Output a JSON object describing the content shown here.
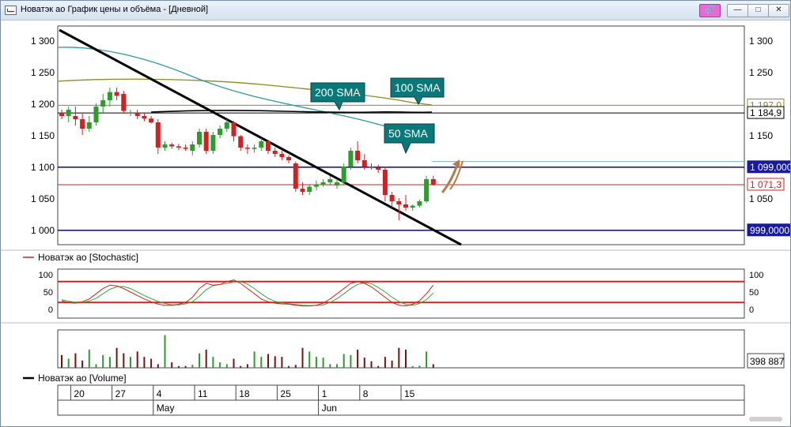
{
  "window": {
    "title": "Новатэк ао График цены и объёма - [Дневной]",
    "pin_icon": "pin-icon",
    "minimize_label": "—",
    "maximize_label": "□",
    "close_label": "✕"
  },
  "price_panel": {
    "y_ticks": [
      "1 300",
      "1 250",
      "1 200",
      "1 150",
      "1 100",
      "1 050",
      "1 000"
    ],
    "right_labels": [
      {
        "text": "1 197,0",
        "value": 1197.0,
        "color": "#8b8b1e"
      },
      {
        "text": "1 184,9",
        "value": 1184.9,
        "color": "#000000"
      },
      {
        "text": "1 099,000",
        "value": 1099.0,
        "color": "#1a1aa0"
      },
      {
        "text": "1 071,3",
        "value": 1071.3,
        "color": "#cc2222"
      },
      {
        "text": "999,0000",
        "value": 999.0,
        "color": "#1a1aa0"
      }
    ],
    "callouts": [
      "200 SMA",
      "100 SMA",
      "50 SMA"
    ]
  },
  "stoch_panel": {
    "legend": "Новатэк ао [Stochastic]",
    "y_ticks": [
      "100",
      "50",
      "0"
    ]
  },
  "volume_panel": {
    "legend": "Новатэк ао [Volume]",
    "last_value": "398 887"
  },
  "x_axis": {
    "day_labels": [
      "20",
      "27",
      "4",
      "11",
      "18",
      "25",
      "1",
      "8",
      "15"
    ],
    "month_labels": [
      "May",
      "Jun"
    ]
  },
  "chart_data": {
    "type": "candlestick",
    "ylim": [
      975,
      1320
    ],
    "levels": {
      "resistance_1": 1184.9,
      "sma200_last": 1197.0,
      "support_upper": 1099.0,
      "last_price": 1071.3,
      "support_lower": 999.0
    },
    "candles": [
      [
        1185,
        1190,
        1175,
        1180
      ],
      [
        1180,
        1195,
        1170,
        1190
      ],
      [
        1180,
        1195,
        1165,
        1175
      ],
      [
        1175,
        1185,
        1150,
        1160
      ],
      [
        1160,
        1180,
        1155,
        1170
      ],
      [
        1170,
        1200,
        1165,
        1195
      ],
      [
        1195,
        1215,
        1185,
        1205
      ],
      [
        1205,
        1225,
        1195,
        1218
      ],
      [
        1218,
        1225,
        1205,
        1212
      ],
      [
        1215,
        1220,
        1185,
        1188
      ],
      [
        1185,
        1190,
        1180,
        1185
      ],
      [
        1185,
        1190,
        1175,
        1180
      ],
      [
        1180,
        1185,
        1172,
        1176
      ],
      [
        1176,
        1180,
        1168,
        1170
      ],
      [
        1170,
        1175,
        1120,
        1130
      ],
      [
        1130,
        1140,
        1125,
        1135
      ],
      [
        1135,
        1138,
        1128,
        1132
      ],
      [
        1132,
        1136,
        1126,
        1130
      ],
      [
        1130,
        1135,
        1125,
        1128
      ],
      [
        1125,
        1140,
        1118,
        1135
      ],
      [
        1135,
        1160,
        1130,
        1155
      ],
      [
        1155,
        1160,
        1120,
        1125
      ],
      [
        1125,
        1155,
        1120,
        1150
      ],
      [
        1150,
        1165,
        1145,
        1160
      ],
      [
        1160,
        1175,
        1155,
        1170
      ],
      [
        1170,
        1172,
        1140,
        1148
      ],
      [
        1148,
        1150,
        1125,
        1130
      ],
      [
        1130,
        1135,
        1120,
        1128
      ],
      [
        1128,
        1135,
        1122,
        1130
      ],
      [
        1130,
        1145,
        1125,
        1140
      ],
      [
        1140,
        1142,
        1120,
        1125
      ],
      [
        1125,
        1130,
        1115,
        1120
      ],
      [
        1120,
        1125,
        1110,
        1115
      ],
      [
        1115,
        1118,
        1105,
        1110
      ],
      [
        1105,
        1108,
        1060,
        1065
      ],
      [
        1065,
        1075,
        1055,
        1060
      ],
      [
        1060,
        1072,
        1055,
        1068
      ],
      [
        1068,
        1078,
        1062,
        1072
      ],
      [
        1072,
        1080,
        1068,
        1075
      ],
      [
        1075,
        1085,
        1070,
        1080
      ],
      [
        1070,
        1080,
        1065,
        1075
      ],
      [
        1075,
        1105,
        1072,
        1100
      ],
      [
        1100,
        1130,
        1095,
        1125
      ],
      [
        1125,
        1140,
        1105,
        1110
      ],
      [
        1110,
        1120,
        1095,
        1100
      ],
      [
        1100,
        1105,
        1095,
        1098
      ],
      [
        1098,
        1103,
        1090,
        1095
      ],
      [
        1095,
        1100,
        1045,
        1055
      ],
      [
        1055,
        1060,
        1035,
        1045
      ],
      [
        1045,
        1050,
        1015,
        1040
      ],
      [
        1040,
        1055,
        1030,
        1035
      ],
      [
        1035,
        1040,
        1030,
        1038
      ],
      [
        1038,
        1048,
        1035,
        1045
      ],
      [
        1045,
        1085,
        1042,
        1080
      ],
      [
        1080,
        1085,
        1070,
        1071
      ]
    ],
    "stochastic": {
      "overbought": 80,
      "oversold": 20,
      "k": [
        25,
        20,
        18,
        22,
        30,
        45,
        60,
        70,
        68,
        60,
        50,
        40,
        30,
        22,
        15,
        12,
        12,
        15,
        20,
        35,
        60,
        75,
        70,
        72,
        80,
        85,
        75,
        60,
        45,
        30,
        22,
        18,
        16,
        15,
        12,
        10,
        10,
        12,
        18,
        30,
        45,
        60,
        75,
        80,
        75,
        65,
        50,
        35,
        20,
        12,
        10,
        15,
        25,
        45,
        70
      ],
      "d": [
        28,
        24,
        20,
        20,
        24,
        32,
        45,
        58,
        65,
        66,
        60,
        50,
        40,
        31,
        23,
        17,
        13,
        13,
        16,
        22,
        38,
        57,
        68,
        72,
        74,
        79,
        80,
        73,
        60,
        45,
        32,
        23,
        19,
        16,
        14,
        12,
        11,
        11,
        13,
        20,
        31,
        45,
        60,
        72,
        77,
        74,
        63,
        50,
        35,
        23,
        14,
        12,
        17,
        28,
        47
      ]
    },
    "volume": [
      0.35,
      0.25,
      0.4,
      0.2,
      0.5,
      0.1,
      0.35,
      0.3,
      0.55,
      0.4,
      0.3,
      0.45,
      0.3,
      0.25,
      0.1,
      0.9,
      0.15,
      0.05,
      0.05,
      0.08,
      0.4,
      0.5,
      0.3,
      0.15,
      0.1,
      0.25,
      0.05,
      0.1,
      0.45,
      0.3,
      0.38,
      0.32,
      0.3,
      0.05,
      0.08,
      0.55,
      0.45,
      0.3,
      0.28,
      0.1,
      0.1,
      0.38,
      0.35,
      0.5,
      0.28,
      0.18,
      0.05,
      0.3,
      0.2,
      0.55,
      0.5,
      0.05,
      0.06,
      0.45,
      0.1
    ]
  }
}
